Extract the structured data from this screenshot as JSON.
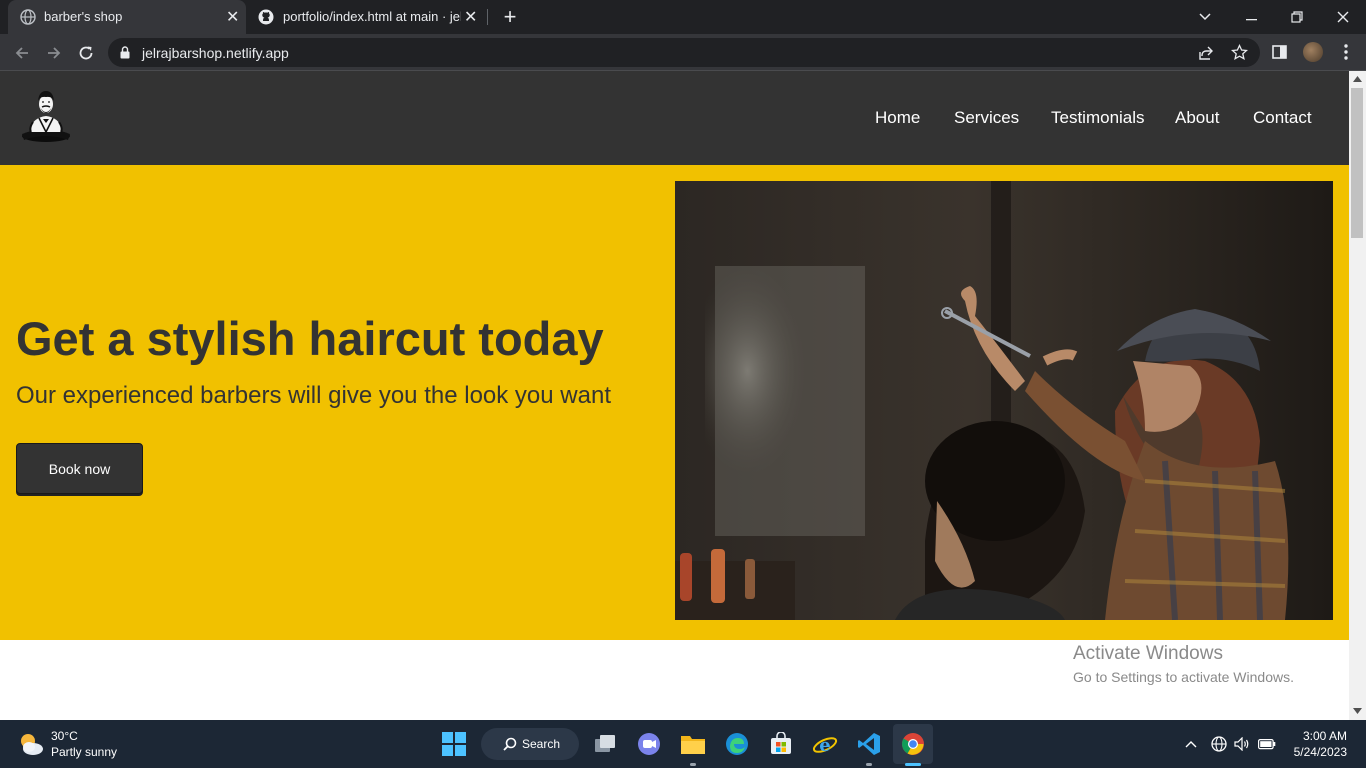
{
  "browser": {
    "tabs": [
      {
        "title": "barber's shop",
        "favicon": "globe-icon",
        "active": true
      },
      {
        "title": "portfolio/index.html at main · jelr",
        "favicon": "github-icon",
        "active": false
      }
    ],
    "url": "jelrajbarshop.netlify.app"
  },
  "site": {
    "nav": [
      "Home",
      "Services",
      "Testimonials",
      "About",
      "Contact"
    ],
    "hero": {
      "title": "Get a stylish haircut today",
      "subtitle": "Our experienced barbers will give you the look you want",
      "button": "Book now"
    },
    "colors": {
      "header": "#333333",
      "hero": "#f1c100"
    }
  },
  "watermark": {
    "line1": "Activate Windows",
    "line2": "Go to Settings to activate Windows."
  },
  "taskbar": {
    "weather": {
      "temp": "30°C",
      "desc": "Partly sunny"
    },
    "search": "Search",
    "time": "3:00 AM",
    "date": "5/24/2023"
  }
}
